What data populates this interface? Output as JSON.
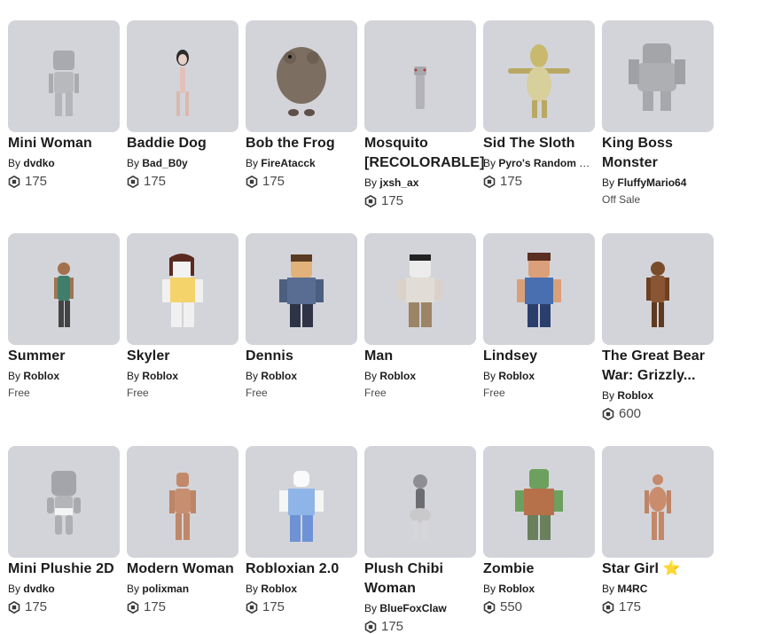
{
  "by_prefix": "By",
  "items": [
    {
      "name": "Mini Woman",
      "creator": "dvdko",
      "price": "175",
      "status": "",
      "figure": "grey-mini"
    },
    {
      "name": "Baddie Dog",
      "creator": "Bad_B0y",
      "price": "175",
      "status": "",
      "figure": "skinny-pale"
    },
    {
      "name": "Bob the Frog",
      "creator": "FireAtacck",
      "price": "175",
      "status": "",
      "figure": "frog"
    },
    {
      "name": "Mosquito [RECOLORABLE]",
      "creator": "jxsh_ax",
      "price": "175",
      "status": "",
      "figure": "mosquito"
    },
    {
      "name": "Sid The Sloth",
      "creator": "Pyro's Random St...",
      "price": "175",
      "status": "",
      "figure": "sloth"
    },
    {
      "name": "King Boss Monster",
      "creator": "FluffyMario64",
      "price": "",
      "status": "Off Sale",
      "figure": "grey-big"
    },
    {
      "name": "Summer",
      "creator": "Roblox",
      "price": "",
      "status": "Free",
      "figure": "summer"
    },
    {
      "name": "Skyler",
      "creator": "Roblox",
      "price": "",
      "status": "Free",
      "figure": "skyler"
    },
    {
      "name": "Dennis",
      "creator": "Roblox",
      "price": "",
      "status": "Free",
      "figure": "dennis"
    },
    {
      "name": "Man",
      "creator": "Roblox",
      "price": "",
      "status": "Free",
      "figure": "man"
    },
    {
      "name": "Lindsey",
      "creator": "Roblox",
      "price": "",
      "status": "Free",
      "figure": "lindsey"
    },
    {
      "name": "The Great Bear War: Grizzly...",
      "creator": "Roblox",
      "price": "600",
      "status": "",
      "figure": "bear"
    },
    {
      "name": "Mini Plushie 2D",
      "creator": "dvdko",
      "price": "175",
      "status": "",
      "figure": "plushie"
    },
    {
      "name": "Modern Woman",
      "creator": "polixman",
      "price": "175",
      "status": "",
      "figure": "modern"
    },
    {
      "name": "Robloxian 2.0",
      "creator": "Roblox",
      "price": "175",
      "status": "",
      "figure": "robloxian"
    },
    {
      "name": "Plush Chibi Woman",
      "creator": "BlueFoxClaw",
      "price": "175",
      "status": "",
      "figure": "chibi"
    },
    {
      "name": "Zombie",
      "creator": "Roblox",
      "price": "550",
      "status": "",
      "figure": "zombie"
    },
    {
      "name": "Star Girl",
      "creator": "M4RC",
      "price": "175",
      "status": "",
      "figure": "stargirl",
      "star": true
    }
  ],
  "colors": {
    "thumb_bg": "#d3d4d9",
    "star": "#f5b800",
    "price_text": "#4a4a4a"
  }
}
